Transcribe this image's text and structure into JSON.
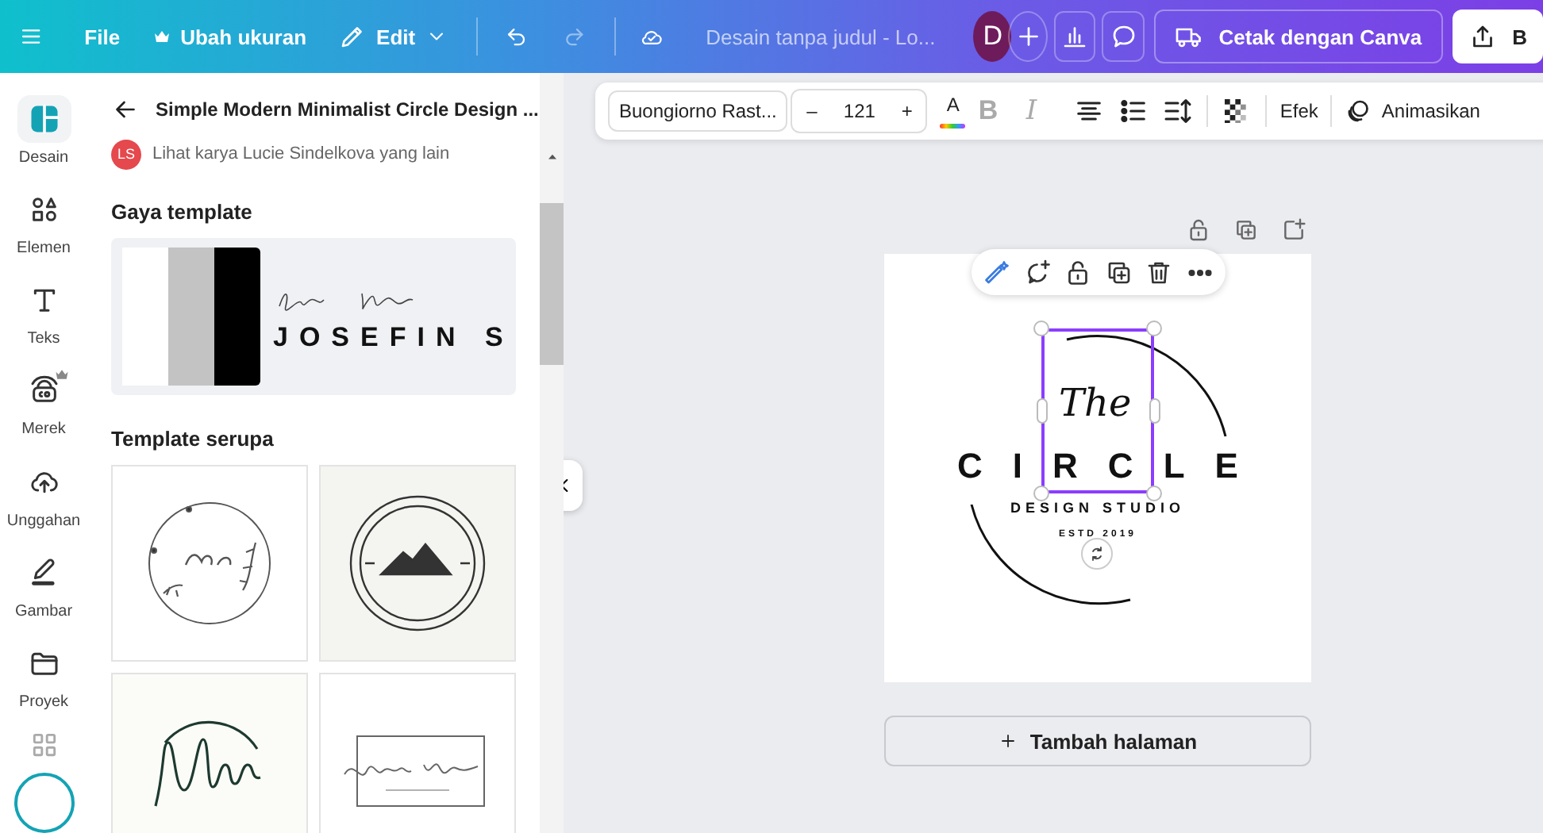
{
  "topbar": {
    "file": "File",
    "resize": "Ubah ukuran",
    "edit": "Edit",
    "doc_title": "Desain tanpa judul - Lo...",
    "avatar": "D",
    "print_button": "Cetak dengan Canva",
    "share_button": "B"
  },
  "rail": [
    {
      "label": "Desain",
      "kind": "design",
      "selected": true,
      "premium": false
    },
    {
      "label": "Elemen",
      "kind": "elements",
      "selected": false,
      "premium": false
    },
    {
      "label": "Teks",
      "kind": "text",
      "selected": false,
      "premium": false
    },
    {
      "label": "Merek",
      "kind": "brand",
      "selected": false,
      "premium": true
    },
    {
      "label": "Unggahan",
      "kind": "upload",
      "selected": false,
      "premium": false
    },
    {
      "label": "Gambar",
      "kind": "draw",
      "selected": false,
      "premium": false
    },
    {
      "label": "Proyek",
      "kind": "projects",
      "selected": false,
      "premium": false
    }
  ],
  "panel": {
    "title": "Simple Modern Minimalist Circle Design ...",
    "author_badge": "LS",
    "author_link": "Lihat karya Lucie Sindelkova yang lain",
    "style_heading": "Gaya template",
    "style_preview_text": "JOSEFIN S",
    "similar_heading": "Template serupa",
    "similar_templates": [
      {
        "kind": "wreath"
      },
      {
        "kind": "badge"
      },
      {
        "kind": "script"
      },
      {
        "kind": "signature"
      }
    ]
  },
  "toolbar": {
    "font": "Buongiorno Rast...",
    "size_minus": "–",
    "font_size": "121",
    "size_plus": "+",
    "text_color_glyph": "A",
    "bold_glyph": "B",
    "italic_glyph": "I",
    "effects": "Efek",
    "animate": "Animasikan"
  },
  "canvas": {
    "script_text": "The",
    "title": "CIRCLE",
    "subtitle": "DESIGN STUDIO",
    "estd": "ESTD 2019"
  },
  "add_page_button": "Tambah halaman"
}
